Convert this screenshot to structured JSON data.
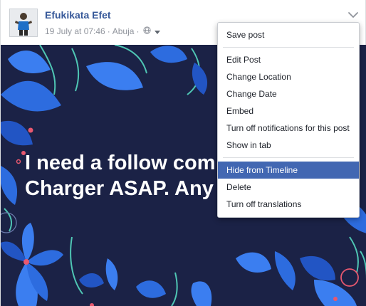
{
  "post": {
    "author_name": "Efukikata Efet",
    "date": "19 July at 07:46",
    "location": "Abuja",
    "separator": "·",
    "image_text": {
      "line1": "I need a follow com",
      "line2": "Charger ASAP. Any"
    }
  },
  "menu": {
    "save": "Save post",
    "edit": "Edit Post",
    "change_location": "Change Location",
    "change_date": "Change Date",
    "embed": "Embed",
    "turn_off_notifications": "Turn off notifications for this post",
    "show_in_tab": "Show in tab",
    "hide": "Hide from Timeline",
    "delete": "Delete",
    "turn_off_translations": "Turn off translations",
    "highlighted_item": "Hide from Timeline"
  },
  "colors": {
    "author_link": "#365899",
    "menu_highlight": "#4267b2",
    "image_background": "#1b2246",
    "leaf_blue": "#2d6cdf",
    "stem_teal": "#4fc6b4",
    "accent_pink": "#e8586f"
  },
  "icons": [
    "globe-icon",
    "caret-down-icon",
    "chevron-down-icon",
    "avatar"
  ]
}
